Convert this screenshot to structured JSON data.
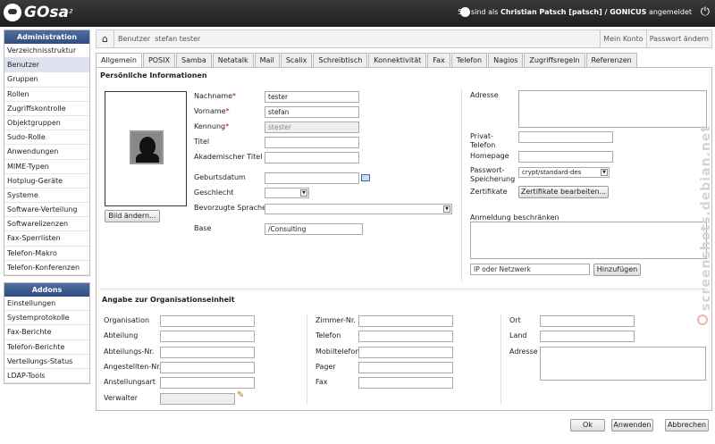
{
  "topbar": {
    "logo": "GOsa",
    "logo_sup": "²",
    "user_prefix": "Sie sind als",
    "user_name": "Christian Patsch [patsch] / GONICUS",
    "user_suffix": "angemeldet"
  },
  "sidebar": {
    "admin_title": "Administration",
    "admin_items": [
      "Verzeichnisstruktur",
      "Benutzer",
      "Gruppen",
      "Rollen",
      "Zugriffskontrolle",
      "Objektgruppen",
      "Sudo-Rolle",
      "Anwendungen",
      "MIME-Typen",
      "Hotplug-Geräte",
      "Systeme",
      "Software-Verteilung",
      "Softwarelizenzen",
      "Fax-Sperrlisten",
      "Telefon-Makro",
      "Telefon-Konferenzen"
    ],
    "addons_title": "Addons",
    "addons_items": [
      "Einstellungen",
      "Systemprotokolle",
      "Fax-Berichte",
      "Telefon-Berichte",
      "Verteilungs-Status",
      "LDAP-Tools"
    ]
  },
  "breadcrumb": {
    "section": "Benutzer",
    "item": "stefan tester",
    "my_account": "Mein Konto",
    "change_password": "Passwort ändern"
  },
  "tabs": [
    "Allgemein",
    "POSIX",
    "Samba",
    "Netatalk",
    "Mail",
    "Scalix",
    "Schreibtisch",
    "Konnektivität",
    "Fax",
    "Telefon",
    "Nagios",
    "Zugriffsregeln",
    "Referenzen"
  ],
  "personal": {
    "title": "Persönliche Informationen",
    "lastname_label": "Nachname",
    "lastname": "tester",
    "firstname_label": "Vorname",
    "firstname": "stefan",
    "uid_label": "Kennung",
    "uid": "stester",
    "title_label": "Titel",
    "title_value": "",
    "academic_label": "Akademischer Titel",
    "academic_value": "",
    "birthdate_label": "Geburtsdatum",
    "birthdate": "",
    "gender_label": "Geschlecht",
    "gender": "",
    "language_label": "Bevorzugte Sprache",
    "language": "",
    "base_label": "Base",
    "base": "/Consulting",
    "change_picture": "Bild ändern..."
  },
  "right": {
    "address_label": "Adresse",
    "private_phone_label1": "Privat-",
    "private_phone_label2": "Telefon",
    "homepage_label": "Homepage",
    "pw_label1": "Passwort-",
    "pw_label2": "Speicherung",
    "pw_value": "crypt/standard-des",
    "cert_label": "Zertifikate",
    "cert_button": "Zertifikate bearbeiten...",
    "restrict_label": "Anmeldung beschränken",
    "ip_placeholder": "IP oder Netzwerk",
    "add_button": "Hinzufügen"
  },
  "org": {
    "title": "Angabe zur Organisationseinheit",
    "col1": [
      "Organisation",
      "Abteilung",
      "Abteilungs-Nr.",
      "Angestellten-Nr.",
      "Anstellungsart",
      "Verwalter"
    ],
    "col2": [
      "Zimmer-Nr.",
      "Telefon",
      "Mobiltelefon",
      "Pager",
      "Fax"
    ],
    "col3": [
      "Ort",
      "Land",
      "Adresse"
    ]
  },
  "footer": {
    "ok": "Ok",
    "apply": "Anwenden",
    "cancel": "Abbrechen"
  },
  "watermark": "screenshots.debian.net"
}
